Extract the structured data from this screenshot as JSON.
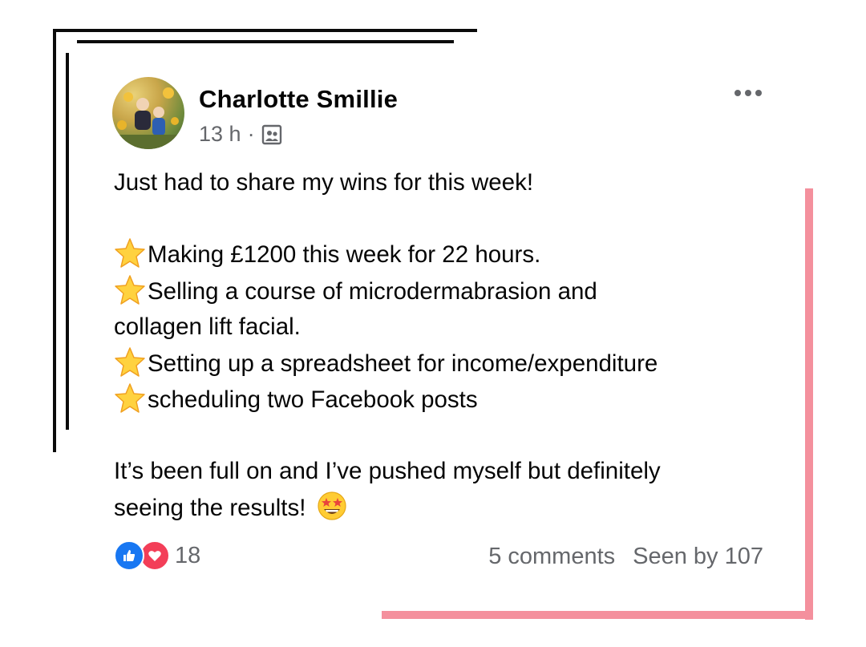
{
  "post": {
    "author": "Charlotte Smillie",
    "time": "13 h",
    "separator": "·",
    "audience_icon": "group-icon",
    "more_icon": "more-options-icon",
    "lines": {
      "intro": "Just had to share my wins for this week!",
      "win1": "Making £1200 this week for 22 hours.",
      "win2a": "Selling a course of microdermabrasion and",
      "win2b": "collagen lift facial.",
      "win3": "Setting up a spreadsheet for income/expenditure",
      "win4": "scheduling two Facebook posts",
      "outro1": "It’s been full on and I’ve pushed myself but definitely",
      "outro2": "seeing the results!"
    },
    "bullet_icon": "star-emoji",
    "outro_emoji": "star-struck-emoji"
  },
  "footer": {
    "reaction_icons": [
      "like-icon",
      "love-icon"
    ],
    "reaction_count": "18",
    "comments": "5 comments",
    "seen": "Seen by 107"
  },
  "colors": {
    "text": "#050505",
    "secondary": "#65676b",
    "like": "#1877f2",
    "love": "#f33e58",
    "frame": "#0b0b0b",
    "accent_pink": "#f4909d"
  }
}
